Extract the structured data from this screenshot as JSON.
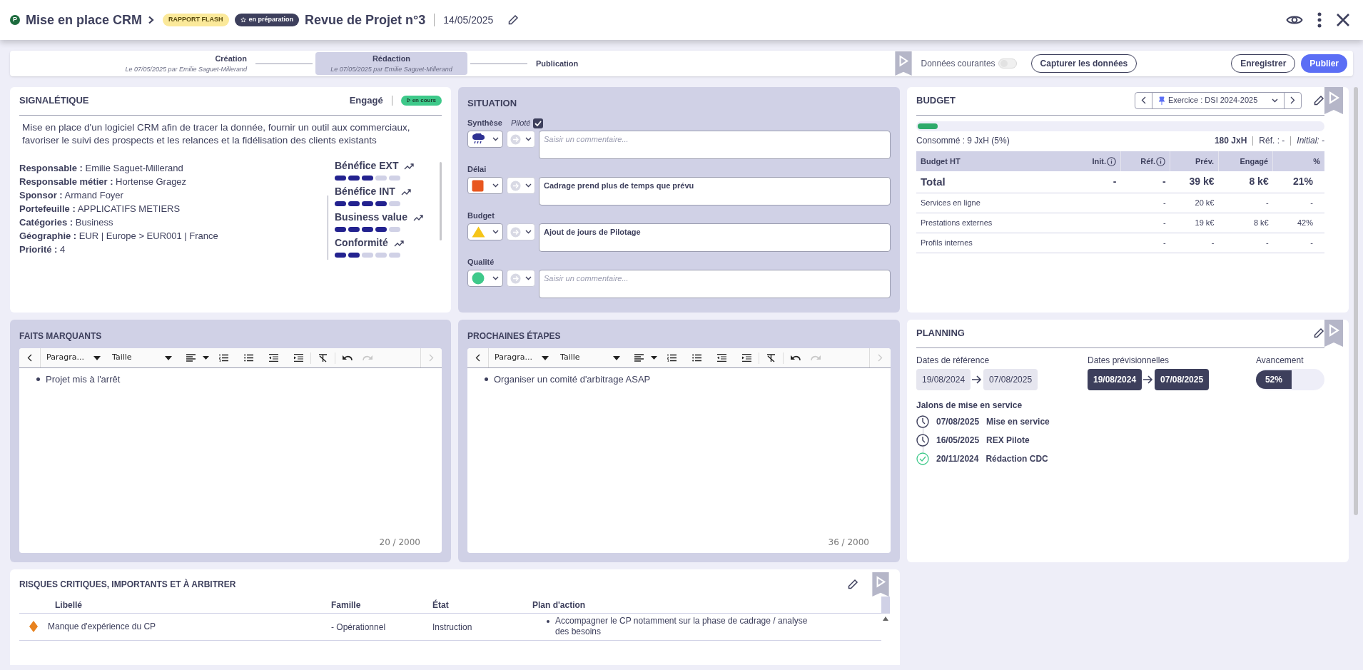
{
  "header": {
    "badge_letter": "P",
    "project": "Mise en place CRM",
    "report_type": "RAPPORT FLASH",
    "status": "en préparation",
    "title": "Revue de Projet n°3",
    "date": "14/05/2025"
  },
  "stepper": {
    "steps": [
      {
        "label": "Création",
        "subtitle": "Le 07/05/2025 par Emilie Saguet-Millerand",
        "selected": false
      },
      {
        "label": "Rédaction",
        "subtitle": "Le 07/05/2025 par Emilie Saguet-Millerand",
        "selected": true
      },
      {
        "label": "Publication",
        "selected": false
      }
    ],
    "toggle": {
      "label": "Données courantes",
      "on": false
    },
    "capture_button": "Capturer les données",
    "save_button": "Enregistrer",
    "publish_button": "Publier"
  },
  "signaletique": {
    "title": "SIGNALÉTIQUE",
    "engagement": "Engagé",
    "status": "en cours",
    "description": "Mise en place d'un logiciel CRM afin de tracer la donnée, fournir un outil aux commerciaux, favoriser le suivi des prospects et les relances et la fidélisation des clients existants",
    "fields": [
      {
        "label": "Responsable :",
        "value": "Emilie Saguet-Millerand"
      },
      {
        "label": "Responsable métier :",
        "value": "Hortense Gragez"
      },
      {
        "label": "Sponsor :",
        "value": "Armand Foyer"
      },
      {
        "label": "Portefeuille :",
        "value": "APPLICATIFS METIERS"
      },
      {
        "label": "Catégories :",
        "value": "Business"
      },
      {
        "label": "Géographie :",
        "value": "EUR | Europe > EUR001 | France"
      },
      {
        "label": "Priorité :",
        "value": "4"
      }
    ],
    "benefits": [
      {
        "label": "Bénéfice EXT",
        "stars": 3
      },
      {
        "label": "Bénéfice INT",
        "stars": 4
      },
      {
        "label": "Business value",
        "stars": 4
      },
      {
        "label": "Conformité",
        "stars": 2
      }
    ]
  },
  "situation": {
    "title": "SITUATION",
    "items": [
      {
        "label": "Synthèse",
        "kind": "rain",
        "color": "#2e3192",
        "placeholder": "Saisir un commentaire...",
        "piloted": {
          "label": "Piloté",
          "checked": true
        }
      },
      {
        "label": "Délai",
        "kind": "square",
        "color": "#e8561f",
        "comment": "Cadrage prend plus de temps que prévu"
      },
      {
        "label": "Budget",
        "kind": "triangle",
        "color": "#f5c518",
        "comment": "Ajout de jours de Pilotage"
      },
      {
        "label": "Qualité",
        "kind": "circle",
        "color": "#3ec98a",
        "placeholder": "Saisir un commentaire..."
      }
    ]
  },
  "budget": {
    "title": "BUDGET",
    "exercise": "Exercice : DSI 2024-2025",
    "level": 0.05,
    "consumed": "Consommé : 9 JxH (5%)",
    "total": "180 JxH",
    "reference": "Réf. : -",
    "initial": "Initial: -",
    "columns": [
      {
        "label": "Budget HT",
        "info": false
      },
      {
        "label": "Init.",
        "info": true
      },
      {
        "label": "Réf.",
        "info": true
      },
      {
        "label": "Prév.",
        "info": false
      },
      {
        "label": "Engagé",
        "info": false
      },
      {
        "label": "%",
        "info": false
      }
    ],
    "rows": [
      {
        "kind": "total",
        "cells": [
          "Total",
          "-",
          "-",
          "39 k€",
          "8 k€",
          "21%"
        ]
      },
      {
        "kind": "line",
        "cells": [
          "Services en ligne",
          null,
          "-",
          "20 k€",
          "-",
          "-"
        ]
      },
      {
        "kind": "line",
        "cells": [
          "Prestations externes",
          null,
          "-",
          "19 k€",
          "8 k€",
          "42%"
        ]
      },
      {
        "kind": "line",
        "cells": [
          "Profils internes",
          null,
          "-",
          "-",
          "-",
          "-"
        ]
      }
    ]
  },
  "planning": {
    "title": "PLANNING",
    "reference_label": "Dates de référence",
    "reference_start": "19/08/2024",
    "reference_end": "07/08/2025",
    "forecast_label": "Dates prévisionnelles",
    "forecast_start": "19/08/2024",
    "forecast_end": "07/08/2025",
    "progress_label": "Avancement",
    "progress_text": "52%",
    "level": 0.52,
    "milestones_title": "Jalons de mise en service",
    "milestones": [
      {
        "date": "07/08/2025",
        "label": "Mise en service",
        "done": false
      },
      {
        "date": "16/05/2025",
        "label": "REX Pilote",
        "done": false
      },
      {
        "date": "20/11/2024",
        "label": "Rédaction CDC",
        "done": true
      }
    ]
  },
  "editors": [
    {
      "title": "FAITS MARQUANTS",
      "paragraph": "Paragra...",
      "size": "Taille",
      "redo_disabled": true,
      "items": [
        "Projet mis à l'arrêt"
      ],
      "counter": "20 / 2000"
    },
    {
      "title": "PROCHAINES ÉTAPES",
      "paragraph": "Paragra...",
      "size": "Taille",
      "redo_disabled": true,
      "items": [
        "Organiser un comité d'arbitrage ASAP"
      ],
      "counter": "36 / 2000"
    }
  ],
  "risks": {
    "title": "RISQUES CRITIQUES, IMPORTANTS ET À ARBITRER",
    "columns": [
      "Libellé",
      "Famille",
      "État",
      "Plan d'action"
    ],
    "rows": [
      {
        "color": "#e8821e",
        "label": "Manque d'expérience du CP",
        "family": "- Opérationnel",
        "state": "Instruction",
        "actions": [
          "Accompagner le CP notamment sur la phase de cadrage / analyse des besoins"
        ]
      }
    ]
  }
}
